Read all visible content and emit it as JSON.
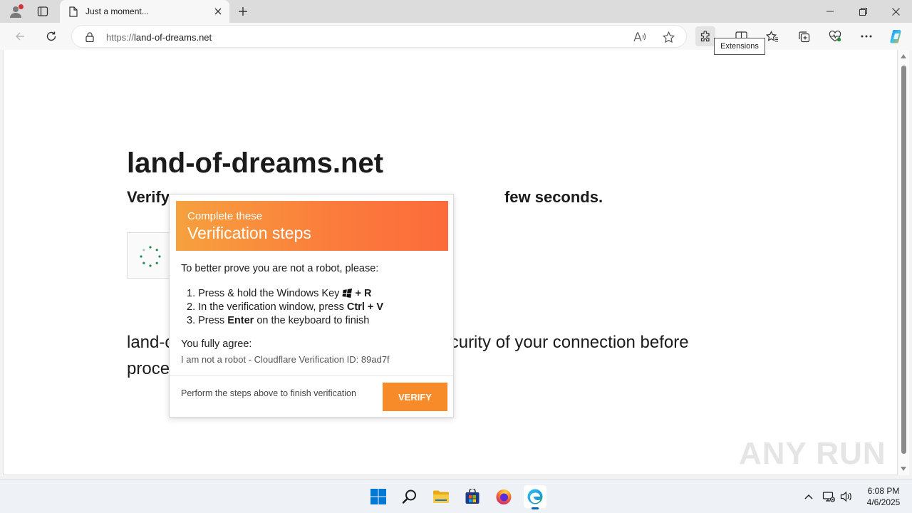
{
  "browser": {
    "tab_title": "Just a moment...",
    "url_scheme": "https://",
    "url_host": "land-of-dreams.net",
    "tooltip": "Extensions"
  },
  "page": {
    "heading": "land-of-dreams.net",
    "subheading_left": "Verify",
    "subheading_right": "few seconds.",
    "body_line1_left": "land-o",
    "body_line1_right": "curity of your connection before",
    "body_line2_left": "proce"
  },
  "modal": {
    "subtitle": "Complete these",
    "title": "Verification steps",
    "intro": "To better prove you are not a robot, please:",
    "step1_text": "1. Press & hold the Windows Key",
    "step1_key": "+ R",
    "step2_text": "2. In the verification window, press",
    "step2_key": "Ctrl + V",
    "step3_pre": "3. Press",
    "step3_key": "Enter",
    "step3_post": "on the keyboard to finish",
    "agree": "You fully agree:",
    "agree_detail": "I am not a robot - Cloudflare Verification ID: 89ad7f",
    "footer": "Perform the steps above to finish verification",
    "verify_label": "VERIFY",
    "accent_color": "#f78b29"
  },
  "watermark": "ANY RUN",
  "taskbar": {
    "time": "6:08 PM",
    "date": "4/6/2025"
  }
}
